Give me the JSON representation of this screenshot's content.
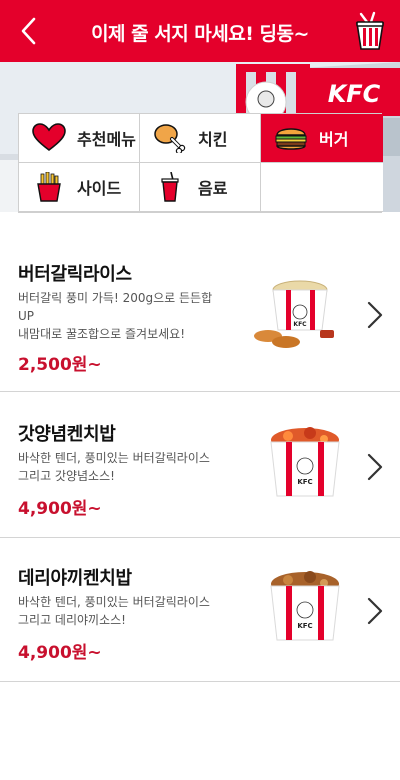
{
  "header": {
    "title": "이제 줄 서지 마세요! 딩동~",
    "back_icon": "chevron-left-icon",
    "cart_icon": "kfc-bucket-icon",
    "brand_color": "#e4002b"
  },
  "banner": {
    "logo_text": "KFC"
  },
  "categories": [
    {
      "label": "추천메뉴",
      "icon": "heart-icon",
      "active": false
    },
    {
      "label": "치킨",
      "icon": "drumstick-icon",
      "active": false
    },
    {
      "label": "버거",
      "icon": "burger-icon",
      "active": true
    },
    {
      "label": "사이드",
      "icon": "fries-icon",
      "active": false
    },
    {
      "label": "음료",
      "icon": "drink-icon",
      "active": false
    }
  ],
  "menu": [
    {
      "name": "버터갈릭라이스",
      "desc": [
        "버터갈릭 풍미 가득! 200g으로 든든합",
        "UP",
        "내맘대로 꿀조합으로 즐겨보세요!"
      ],
      "price": "2,500원~",
      "image_text": "KFC"
    },
    {
      "name": "갓양념켄치밥",
      "desc": [
        "바삭한 텐더, 풍미있는 버터갈릭라이스",
        "그리고 갓양념소스!"
      ],
      "price": "4,900원~",
      "image_text": "KFC"
    },
    {
      "name": "데리야끼켄치밥",
      "desc": [
        "바삭한 텐더, 풍미있는 버터갈릭라이스",
        "그리고 데리야끼소스!"
      ],
      "price": "4,900원~",
      "image_text": "KFC"
    }
  ],
  "colors": {
    "price": "#c8102e",
    "active_tab": "#e4002b"
  }
}
